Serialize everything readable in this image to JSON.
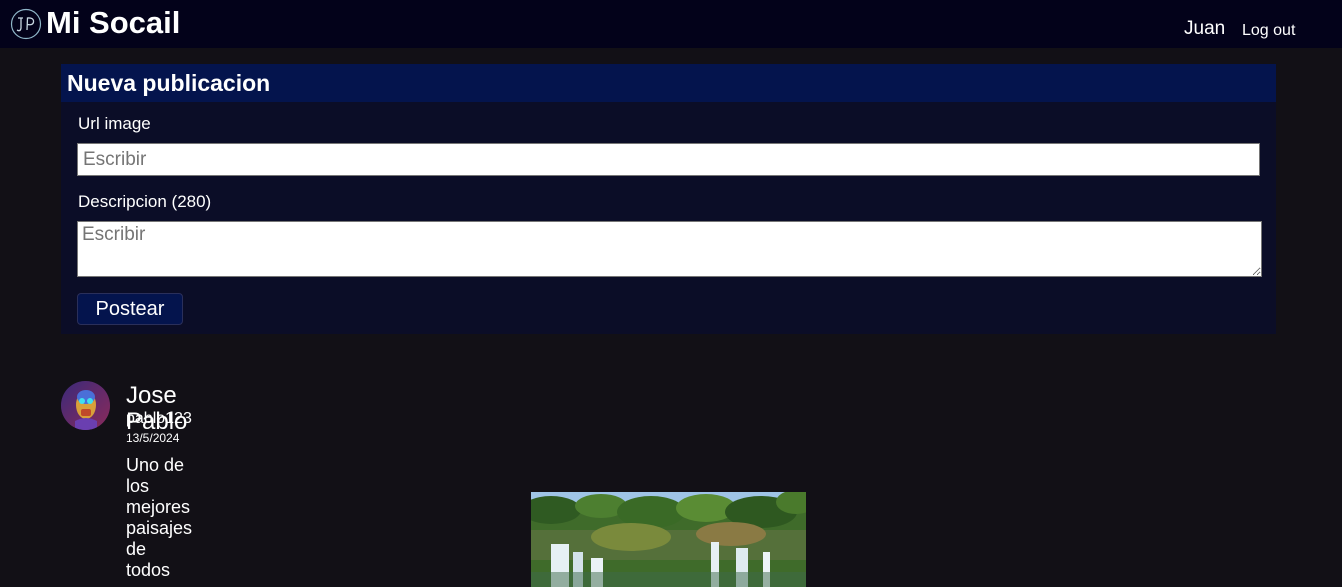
{
  "navbar": {
    "logo_icon": "jp-monogram-logo-icon",
    "brand": "Mi Socail",
    "user": "Juan",
    "logout": "Log out"
  },
  "composer": {
    "title": "Nueva publicacion",
    "url_label": "Url image",
    "url_placeholder": "Escribir",
    "url_value": "",
    "desc_label": "Descripcion (280)",
    "desc_placeholder": "Escribir",
    "desc_value": "",
    "submit_label": "Postear"
  },
  "posts": [
    {
      "avatar_icon": "robot-avatar-icon",
      "name": "Jose Pablo",
      "handle": "pablo123",
      "date": "13/5/2024",
      "text": "Uno de los mejores paisajes de todos",
      "image": "waterfall-landscape-image"
    }
  ],
  "colors": {
    "page_bg": "#121016",
    "navbar_bg": "#03021a",
    "panel_bg": "#0b0d27",
    "panel_header_bg": "#04144d",
    "button_bg": "#04144d",
    "text": "#ffffff"
  }
}
